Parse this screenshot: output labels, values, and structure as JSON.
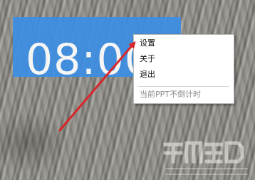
{
  "timer": {
    "display": "08:00"
  },
  "context_menu": {
    "items": [
      {
        "label": "设置"
      },
      {
        "label": "关于"
      },
      {
        "label": "退出"
      }
    ],
    "status_label": "当前PPT不倒计时"
  },
  "annotation": {
    "arrow_color": "#d9262a"
  },
  "colors": {
    "timer_background": "#3d8fe4",
    "timer_text": "#ffffff"
  },
  "icons": {
    "arrow": "red-arrow-icon",
    "watermark": "watermark-logo-icon"
  }
}
